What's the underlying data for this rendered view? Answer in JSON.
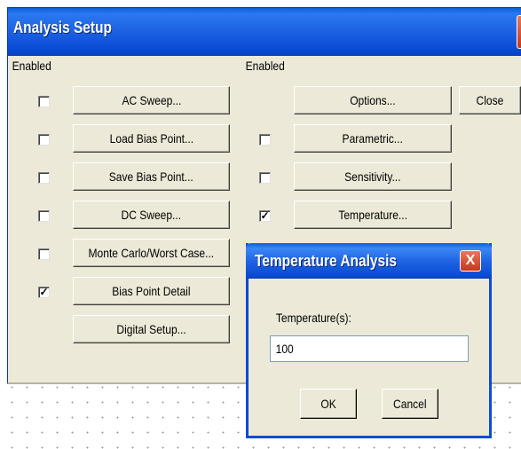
{
  "setup": {
    "title": "Analysis Setup",
    "close_glyph": "X",
    "enabled_label_left": "Enabled",
    "enabled_label_right": "Enabled",
    "left_items": [
      {
        "label": "AC Sweep...",
        "checked": false,
        "check": ""
      },
      {
        "label": "Load Bias Point...",
        "checked": false,
        "check": ""
      },
      {
        "label": "Save Bias Point...",
        "checked": false,
        "check": ""
      },
      {
        "label": "DC Sweep...",
        "checked": false,
        "check": ""
      },
      {
        "label": "Monte Carlo/Worst Case...",
        "checked": false,
        "check": ""
      },
      {
        "label": "Bias Point Detail",
        "checked": true,
        "check": "✓"
      },
      {
        "label": "Digital Setup..."
      }
    ],
    "right_items": [
      {
        "label": "Options..."
      },
      {
        "label": "Parametric...",
        "checked": false,
        "check": ""
      },
      {
        "label": "Sensitivity...",
        "checked": false,
        "check": ""
      },
      {
        "label": "Temperature...",
        "checked": true,
        "check": "✓"
      }
    ],
    "close_button": "Close"
  },
  "temperature_dialog": {
    "title": "Temperature Analysis",
    "close_glyph": "X",
    "field_label": "Temperature(s):",
    "field_value": "100",
    "ok_button": "OK",
    "cancel_button": "Cancel"
  }
}
